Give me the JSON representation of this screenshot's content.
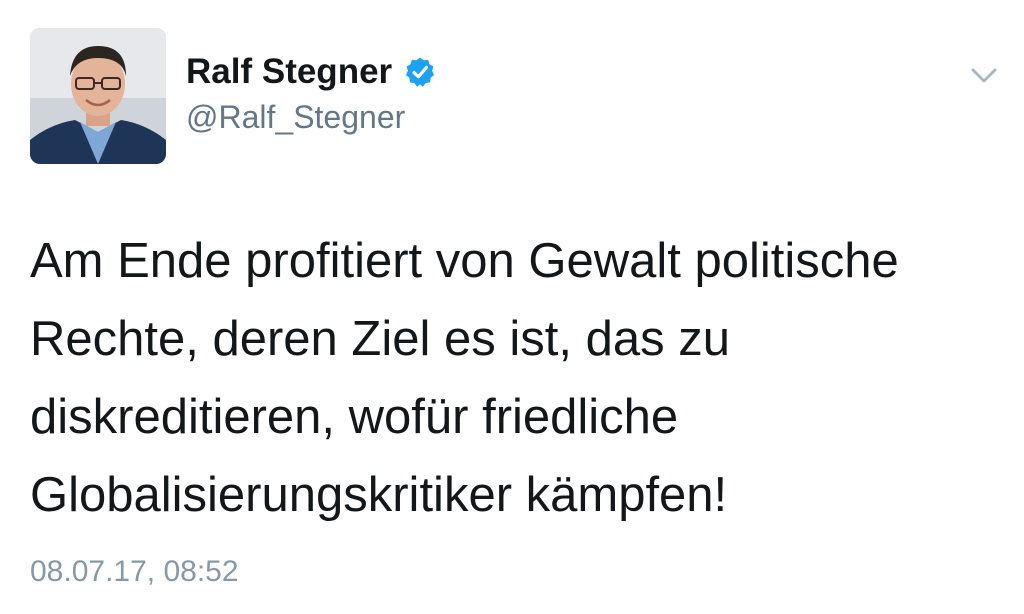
{
  "tweet": {
    "author": {
      "display_name": "Ralf Stegner",
      "handle": "@Ralf_Stegner",
      "verified": true,
      "avatar_icon": "profile-photo"
    },
    "menu_icon": "chevron-down-icon",
    "text": "Am Ende profitiert von Gewalt politische\nRechte, deren Ziel es ist, das zu\ndiskreditieren, wofür friedliche\nGlobalisierungskritiker kämpfen!",
    "timestamp": "08.07.17, 08:52"
  },
  "colors": {
    "verified_badge": "#1da1f2",
    "handle": "#657786",
    "timestamp": "#8899a6",
    "text": "#14171a"
  }
}
